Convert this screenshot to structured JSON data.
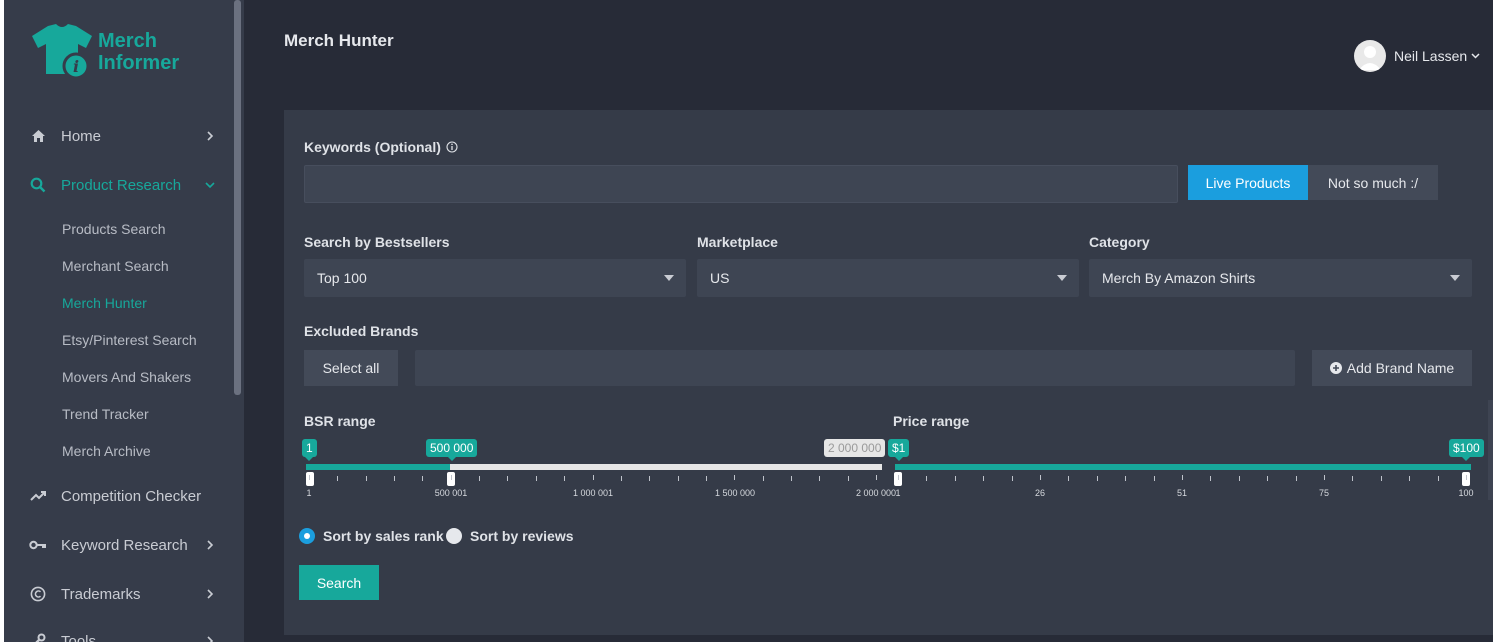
{
  "brand": {
    "line1": "Merch",
    "line2": "Informer"
  },
  "nav": {
    "home": "Home",
    "product_research": "Product Research",
    "sub": [
      "Products Search",
      "Merchant Search",
      "Merch Hunter",
      "Etsy/Pinterest Search",
      "Movers And Shakers",
      "Trend Tracker",
      "Merch Archive"
    ],
    "competition": "Competition Checker",
    "keyword": "Keyword Research",
    "trademarks": "Trademarks",
    "tools": "Tools"
  },
  "header": {
    "title": "Merch Hunter",
    "user": "Neil Lassen"
  },
  "form": {
    "keywords_label": "Keywords (Optional)",
    "keywords_value": "",
    "live_label": "Live Products",
    "not_label": "Not so much :/",
    "bestsellers_label": "Search by Bestsellers",
    "bestsellers_value": "Top 100",
    "marketplace_label": "Marketplace",
    "marketplace_value": "US",
    "category_label": "Category",
    "category_value": "Merch By Amazon Shirts",
    "excluded_label": "Excluded Brands",
    "select_all": "Select all",
    "excluded_value": "",
    "add_brand": "Add Brand Name",
    "bsr_label": "BSR range",
    "price_label": "Price range",
    "sort_rank": "Sort by sales rank",
    "sort_reviews": "Sort by reviews",
    "search": "Search"
  },
  "bsr": {
    "min": "1",
    "from": "500 000",
    "max_tag": "2 000 000",
    "ticks": [
      "1",
      "500 001",
      "1 000 001",
      "1 500 000",
      "2 000 000"
    ],
    "from_value": 500000,
    "domain_max": 2000000
  },
  "price": {
    "from": "$1",
    "to": "$100",
    "ticks": [
      "1",
      "26",
      "51",
      "75",
      "100"
    ]
  },
  "colors": {
    "accent": "#17a89b",
    "blue": "#1b9ede",
    "bg": "#272b37",
    "sidebar": "#363c4a",
    "panel": "#353b48"
  }
}
